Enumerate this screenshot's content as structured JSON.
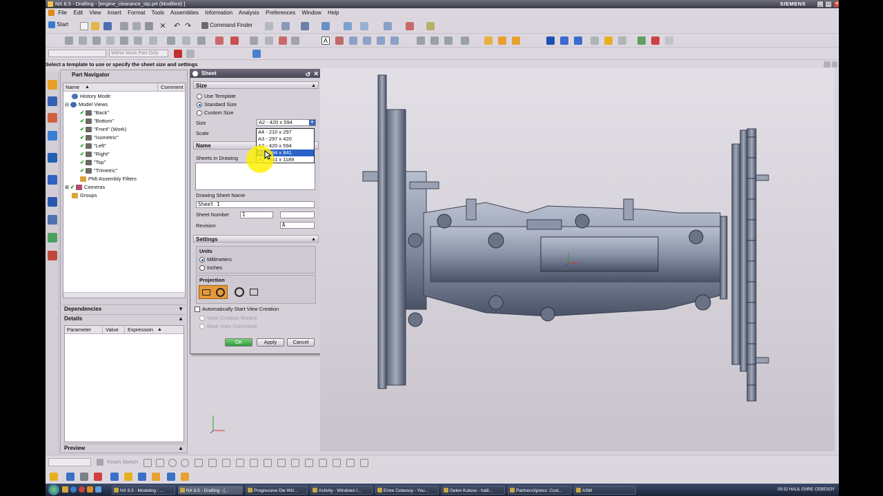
{
  "window": {
    "title": "NX 8.5 - Drafting - [engine_clearance_stp.prt (Modified) ]",
    "brand": "SIEMENS"
  },
  "menu": {
    "items": [
      "File",
      "Edit",
      "View",
      "Insert",
      "Format",
      "Tools",
      "Assemblies",
      "Information",
      "Analysis",
      "Preferences",
      "Window",
      "Help"
    ]
  },
  "toolbar": {
    "start_label": "Start",
    "command_finder": "Command Finder",
    "selection_filter": "Within Work Part Only"
  },
  "cue_line": "Select a template to use or specify the sheet size and settings",
  "navigator": {
    "title": "Part Navigator",
    "col_name": "Name",
    "col_comment": "Comment",
    "items": [
      "History Mode",
      "Model Views",
      "\"Back\"",
      "\"Bottom\"",
      "\"Front\" (Work)",
      "\"Isometric\"",
      "\"Left\"",
      "\"Right\"",
      "\"Top\"",
      "\"Trimetric\"",
      "PMI Assembly Filters",
      "Cameras",
      "Groups"
    ],
    "dependencies": "Dependencies",
    "details": "Details",
    "detail_cols": [
      "Parameter",
      "Value",
      "Expression"
    ],
    "preview": "Preview"
  },
  "dialog": {
    "title": "Sheet",
    "size_group": "Size",
    "radio_template": "Use Template",
    "radio_standard": "Standard Size",
    "radio_custom": "Custom Size",
    "size_label": "Size",
    "size_value": "A2 - 420 x 594",
    "scale_label": "Scale",
    "name_label": "Name",
    "sheets_in_drawing": "Sheets in Drawing",
    "sheet_name_label": "Drawing Sheet Name",
    "sheet_name_value": "Sheet 1",
    "sheet_number_label": "Sheet Number",
    "sheet_number_value": "1",
    "revision_label": "Revision",
    "revision_value": "A",
    "settings_group": "Settings",
    "units_label": "Units",
    "unit_mm": "Millimeters",
    "unit_in": "Inches",
    "projection_label": "Projection",
    "auto_start": "Automatically Start View Creation",
    "view_wizard": "View Creation Wizard",
    "base_view": "Base View Command",
    "ok": "OK",
    "apply": "Apply",
    "cancel": "Cancel",
    "dropdown_options": [
      "A4 - 210 x 297",
      "A3 - 297 x 420",
      "A2 - 420 x 594",
      "A1 - 594 x 841",
      "A0 - 841 x 1189"
    ],
    "dropdown_highlighted": "A1 - 594 x 841"
  },
  "bottom_toolbar": {
    "finish_sketch": "Finish Sketch"
  },
  "taskbar": {
    "tasks": [
      "NX 8.5 - Modeling - ...",
      "NX 8.5 - Drafting - [...",
      "Progressive Die Wiz...",
      "Activity - Windows I...",
      "Emre Cebesoy - You...",
      "Gelen Kutusu - halil...",
      "PartnersXpress: Cust...",
      "ASM"
    ],
    "clock": "09:32 HALIL EMRE CEBESOY"
  },
  "colors": {
    "accent": "#1850b8",
    "check": "#1a9a1a",
    "highlight": "#fff000",
    "model": "#8a93a8"
  }
}
